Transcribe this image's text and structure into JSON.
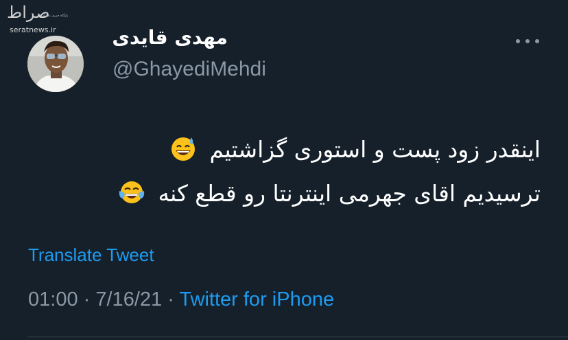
{
  "watermark": {
    "logo_text": "صراط",
    "tagline": "پایگاه خبری تحلیلی",
    "site": "seratnews.ir"
  },
  "tweet": {
    "author": {
      "display_name": "مهدی قایدی",
      "handle": "@GhayediMehdi"
    },
    "more_icon": "more-dots-icon",
    "lines": [
      "اینقدر زود پست و استوری گزاشتیم",
      "ترسیدیم اقای جهرمی اینترنتا رو قطع کنه"
    ],
    "emojis": [
      "grinning-face-with-sweat",
      "face-with-tears-of-joy"
    ],
    "translate_label": "Translate Tweet",
    "time": "01:00",
    "date": "7/16/21",
    "separator": "·",
    "source": "Twitter for iPhone"
  },
  "colors": {
    "background": "#15202b",
    "text": "#ffffff",
    "secondary": "#8b98a5",
    "accent": "#1d9bf0"
  }
}
